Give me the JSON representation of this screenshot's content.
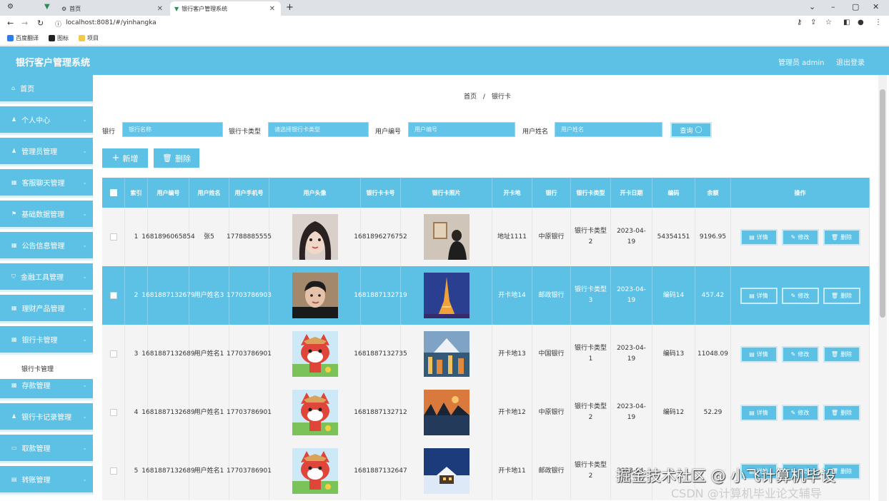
{
  "browser": {
    "tabs": [
      {
        "title": "首页"
      },
      {
        "title": "银行客户管理系统"
      }
    ],
    "url": "localhost:8081/#/yinhangka",
    "bookmarks": [
      "百度翻译",
      "图标",
      "项目"
    ]
  },
  "header": {
    "title": "银行客户管理系统",
    "admin": "管理员 admin",
    "logout": "退出登录"
  },
  "sidebar": {
    "items": [
      {
        "label": "首页",
        "icon": "home-icon"
      },
      {
        "label": "个人中心",
        "icon": "user-icon"
      },
      {
        "label": "管理员管理",
        "icon": "user-icon"
      },
      {
        "label": "客服聊天管理",
        "icon": "grid-icon"
      },
      {
        "label": "基础数据管理",
        "icon": "flag-icon"
      },
      {
        "label": "公告信息管理",
        "icon": "grid-icon"
      },
      {
        "label": "金融工具管理",
        "icon": "shield-icon"
      },
      {
        "label": "理财产品管理",
        "icon": "grid-icon"
      },
      {
        "label": "银行卡管理",
        "icon": "grid-icon"
      },
      {
        "label": "存款管理",
        "icon": "grid-icon"
      },
      {
        "label": "银行卡记录管理",
        "icon": "user-icon"
      },
      {
        "label": "取款管理",
        "icon": "monitor-icon"
      },
      {
        "label": "转账管理",
        "icon": "doc-icon"
      }
    ],
    "sub_item": "银行卡管理"
  },
  "breadcrumb": {
    "home": "首页",
    "sep": "/",
    "current": "银行卡"
  },
  "filters": {
    "bank_label": "银行",
    "bank_placeholder": "银行名称",
    "cardtype_label": "银行卡类型",
    "cardtype_placeholder": "请选择银行卡类型",
    "userno_label": "用户编号",
    "userno_placeholder": "用户编号",
    "username_label": "用户姓名",
    "username_placeholder": "用户姓名",
    "query": "查询"
  },
  "toolbar": {
    "add": "新增",
    "delete": "删除"
  },
  "table": {
    "headers": [
      "",
      "索引",
      "用户编号",
      "用户姓名",
      "用户手机号",
      "用户头像",
      "银行卡卡号",
      "银行卡照片",
      "开卡地",
      "银行",
      "银行卡类型",
      "开卡日期",
      "编码",
      "余额",
      "操作"
    ],
    "rows": [
      {
        "index": "1",
        "user_no": "1681896065854",
        "user_name": "张5",
        "phone": "17788885555",
        "card_no": "1681896276752",
        "addr": "地址1111",
        "bank": "中原银行",
        "type": "银行卡类型2",
        "date": "2023-04-19",
        "code": "54354151",
        "balance": "9196.95",
        "avatar": "girl",
        "photo": "wall"
      },
      {
        "index": "2",
        "user_no": "1681887132679",
        "user_name": "用户姓名3",
        "phone": "17703786903",
        "card_no": "1681887132719",
        "addr": "开卡地14",
        "bank": "邮政银行",
        "type": "银行卡类型3",
        "date": "2023-04-19",
        "code": "编码14",
        "balance": "457.42",
        "avatar": "boy",
        "photo": "tower"
      },
      {
        "index": "3",
        "user_no": "1681887132689",
        "user_name": "用户姓名1",
        "phone": "17703786901",
        "card_no": "1681887132735",
        "addr": "开卡地13",
        "bank": "中国银行",
        "type": "银行卡类型1",
        "date": "2023-04-19",
        "code": "编码13",
        "balance": "11048.09",
        "avatar": "fox",
        "photo": "city"
      },
      {
        "index": "4",
        "user_no": "1681887132689",
        "user_name": "用户姓名1",
        "phone": "17703786901",
        "card_no": "1681887132712",
        "addr": "开卡地12",
        "bank": "中原银行",
        "type": "银行卡类型2",
        "date": "2023-04-19",
        "code": "编码12",
        "balance": "52.29",
        "avatar": "fox",
        "photo": "lake"
      },
      {
        "index": "5",
        "user_no": "1681887132689",
        "user_name": "用户姓名1",
        "phone": "17703786901",
        "card_no": "1681887132647",
        "addr": "开卡地11",
        "bank": "邮政银行",
        "type": "银行卡类型2",
        "date": "2023-04-",
        "code": "",
        "balance": "",
        "avatar": "fox",
        "photo": "snow"
      }
    ],
    "actions": {
      "detail": "详情",
      "edit": "修改",
      "delete": "删除"
    }
  },
  "watermark": {
    "line1": "掘金技术社区 @ 小飞计算机毕设",
    "line2": "CSDN @计算机毕业论文辅导"
  }
}
